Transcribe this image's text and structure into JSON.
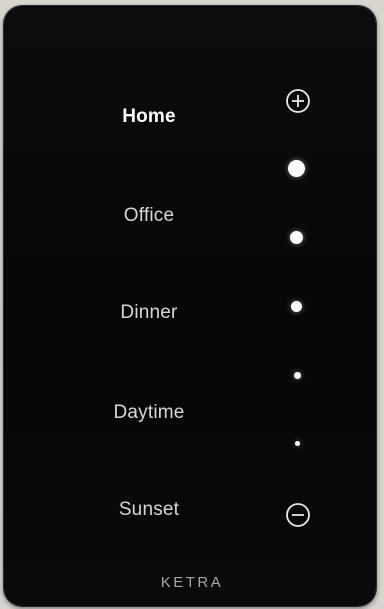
{
  "scenes": [
    {
      "label": "Home",
      "selected": true
    },
    {
      "label": "Office",
      "selected": false
    },
    {
      "label": "Dinner",
      "selected": false
    },
    {
      "label": "Daytime",
      "selected": false
    },
    {
      "label": "Sunset",
      "selected": false
    }
  ],
  "controls": {
    "increase_icon": "plus-circle",
    "decrease_icon": "minus-circle"
  },
  "brightness_indicator": {
    "steps": 5,
    "level_icon": "dot"
  },
  "brand": "KETRA",
  "colors": {
    "panel": "#080808",
    "text": "#d7d7d7",
    "selected_text": "#ffffff",
    "indicator": "#ffffff",
    "brand": "#a6a6a6"
  }
}
